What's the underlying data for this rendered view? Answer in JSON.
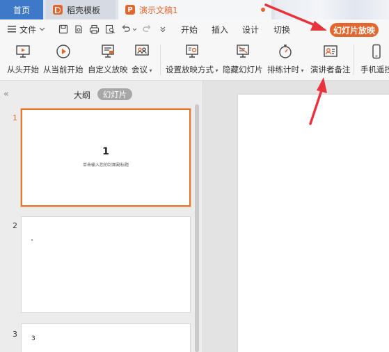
{
  "tabs": {
    "home": "首页",
    "template": "稻壳模板",
    "document": "演示文稿1"
  },
  "menu": {
    "file": "文件",
    "items": [
      "开始",
      "插入",
      "设计",
      "切换"
    ],
    "slideshow": "幻灯片放映"
  },
  "ribbon": {
    "from_start": "从头开始",
    "from_current": "从当前开始",
    "custom_show": "自定义放映",
    "meeting": "会议",
    "setup_show": "设置放映方式",
    "hide_slide": "隐藏幻灯片",
    "rehearse": "排练计时",
    "presenter_notes": "演讲者备注",
    "phone_remote": "手机遥控"
  },
  "panel": {
    "outline_tab": "大纲",
    "slides_tab": "幻灯片",
    "slides": [
      {
        "number": "1",
        "title": "1",
        "subtitle": "单击输入您的封面副标题"
      },
      {
        "number": "2",
        "title": "",
        "subtitle": ""
      },
      {
        "number": "3",
        "title": "3",
        "subtitle": ""
      }
    ]
  },
  "colors": {
    "accent": "#e2662e",
    "home_tab": "#3e78c8",
    "annotation_arrow": "#e8323c"
  }
}
